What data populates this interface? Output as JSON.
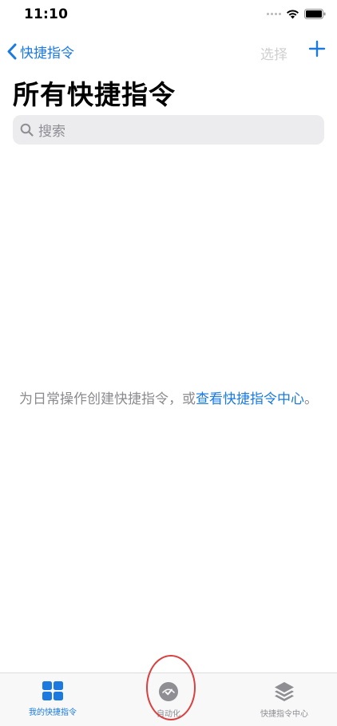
{
  "status_bar": {
    "time": "11:10"
  },
  "nav": {
    "back_label": "快捷指令",
    "select_label": "选择"
  },
  "page": {
    "title": "所有快捷指令"
  },
  "search": {
    "placeholder": "搜索"
  },
  "empty_state": {
    "text_prefix": "为日常操作创建快捷指令，或",
    "link_text": "查看快捷指令中心",
    "text_suffix": "。"
  },
  "tab_bar": {
    "tabs": [
      {
        "label": "我的快捷指令",
        "icon": "grid-icon",
        "active": true
      },
      {
        "label": "自动化",
        "icon": "automation-clock-icon",
        "active": false
      },
      {
        "label": "快捷指令中心",
        "icon": "layers-icon",
        "active": false
      }
    ]
  },
  "colors": {
    "accent": "#1a7ae0",
    "annotation": "#d94040",
    "inactive": "#8e8e93"
  }
}
